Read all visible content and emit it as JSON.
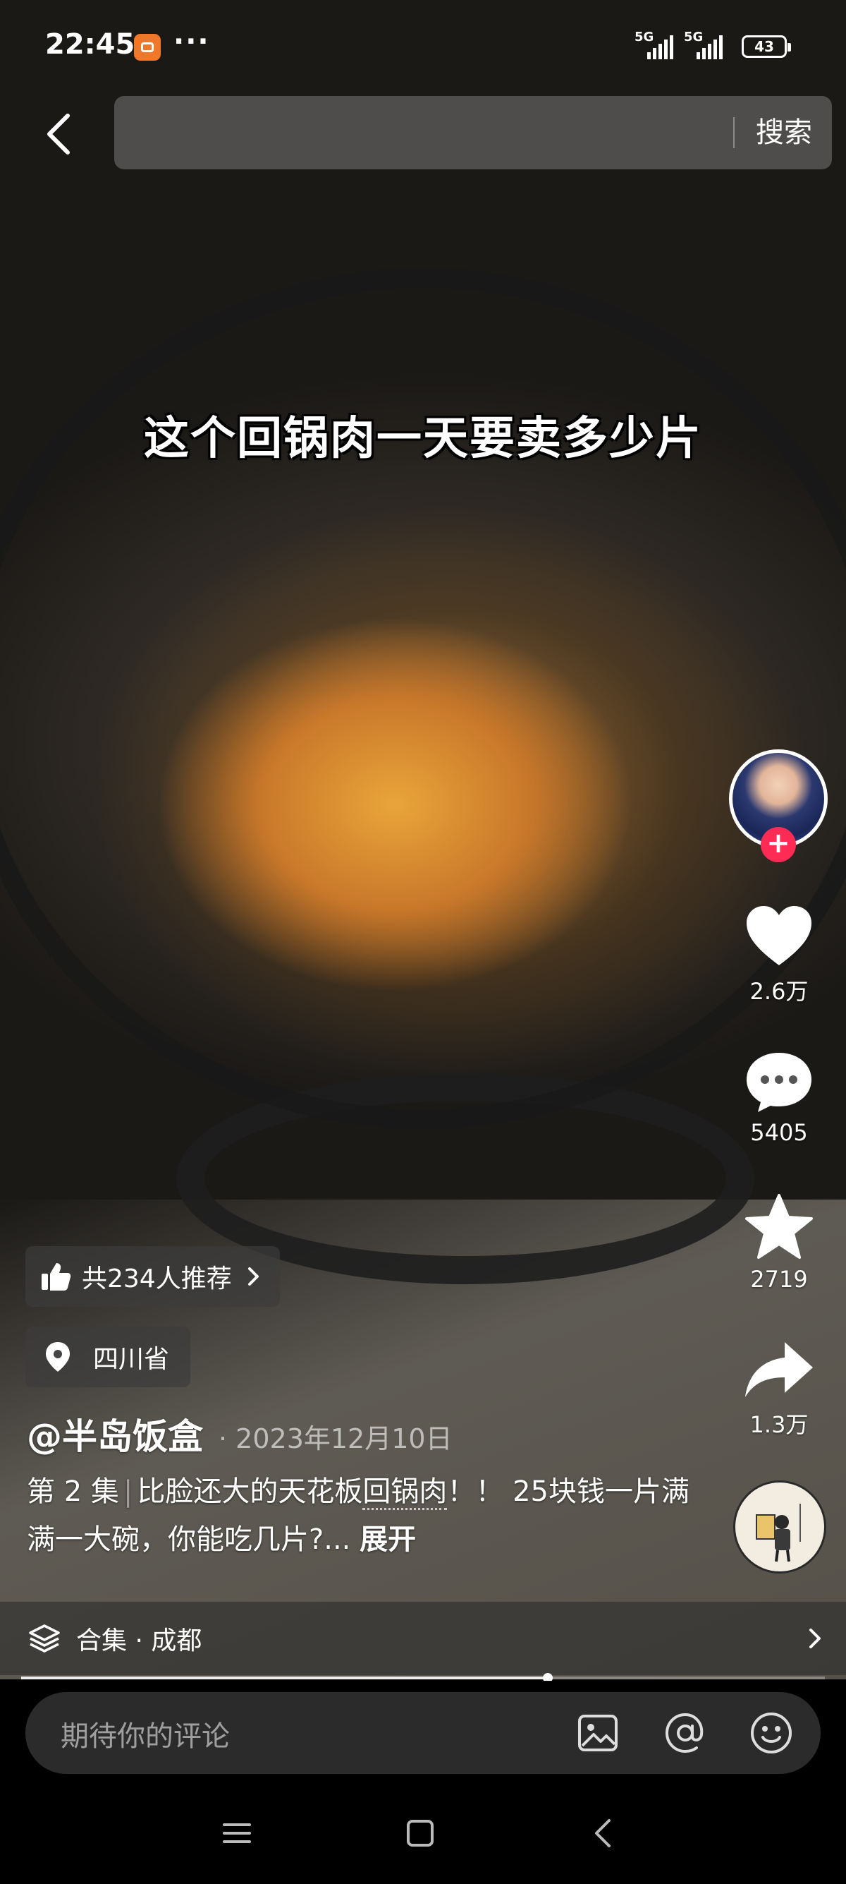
{
  "status_bar": {
    "time": "22:45",
    "more_dots": "···",
    "signal_1_label": "5G",
    "signal_2_label": "5G",
    "battery": "43"
  },
  "search": {
    "button_label": "搜索"
  },
  "video": {
    "caption": "这个回锅肉一天要卖多少片",
    "progress_fraction": 0.655
  },
  "actions": {
    "likes": "2.6万",
    "comments": "5405",
    "favorites": "2719",
    "shares": "1.3万"
  },
  "recommend_pill": {
    "label": "共234人推荐"
  },
  "location_pill": {
    "label": "四川省"
  },
  "post": {
    "author": "@半岛饭盒",
    "date": "· 2023年12月10日",
    "episode": "第 2 集",
    "episode_separator": "|",
    "text_before_tag": "比脸还大的天花板",
    "tag": "回锅肉",
    "text_after_tag": "！！ 25块钱一片满满一大碗，你能吃几片?...",
    "expand_label": "展开"
  },
  "collection": {
    "label": "合集 · 成都"
  },
  "comment": {
    "placeholder": "期待你的评论"
  },
  "icons": {
    "back": "chevron-left-icon",
    "like": "heart-icon",
    "comment": "speech-bubble-icon",
    "favorite": "star-icon",
    "share": "share-arrow-icon",
    "collection": "layers-icon",
    "image": "image-icon",
    "mention": "at-icon",
    "emoji": "smiley-icon"
  },
  "colors": {
    "follow_plus": "#fe2c55",
    "app_badge": "#f0782b"
  }
}
